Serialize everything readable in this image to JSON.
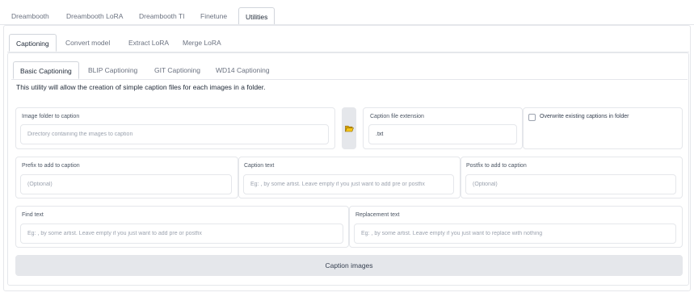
{
  "main_tabs": [
    {
      "label": "Dreambooth"
    },
    {
      "label": "Dreambooth LoRA"
    },
    {
      "label": "Dreambooth TI"
    },
    {
      "label": "Finetune"
    },
    {
      "label": "Utilities"
    }
  ],
  "utility_tabs": [
    {
      "label": "Captioning"
    },
    {
      "label": "Convert model"
    },
    {
      "label": "Extract LoRA"
    },
    {
      "label": "Merge LoRA"
    }
  ],
  "caption_tabs": [
    {
      "label": "Basic Captioning"
    },
    {
      "label": "BLIP Captioning"
    },
    {
      "label": "GIT Captioning"
    },
    {
      "label": "WD14 Captioning"
    }
  ],
  "description": "This utility will allow the creation of simple caption files for each images in a folder.",
  "fields": {
    "image_folder": {
      "label": "Image folder to caption",
      "placeholder": "Directory containing the images to caption",
      "value": ""
    },
    "caption_ext": {
      "label": "Caption file extension",
      "value": ".txt"
    },
    "overwrite": {
      "label": "Overwrite existing captions in folder",
      "checked": false
    },
    "prefix": {
      "label": "Prefix to add to caption",
      "placeholder": "(Optional)"
    },
    "caption_text": {
      "label": "Caption text",
      "placeholder": "Eg: , by some artist. Leave empty if you just want to add pre or postfix"
    },
    "postfix": {
      "label": "Postfix to add to caption",
      "placeholder": "(Optional)"
    },
    "find_text": {
      "label": "Find text",
      "placeholder": "Eg: , by some artist. Leave empty if you just want to add pre or postfix"
    },
    "replacement_text": {
      "label": "Replacement text",
      "placeholder": "Eg: , by some artist. Leave empty if you just want to replace with nothing"
    }
  },
  "run_button": {
    "label": "Caption images"
  },
  "colors": {
    "folder_icon": "#f5c518",
    "active_tab_border": "#d1d5db"
  },
  "icons": {
    "folder_button": "folder-open-icon"
  }
}
